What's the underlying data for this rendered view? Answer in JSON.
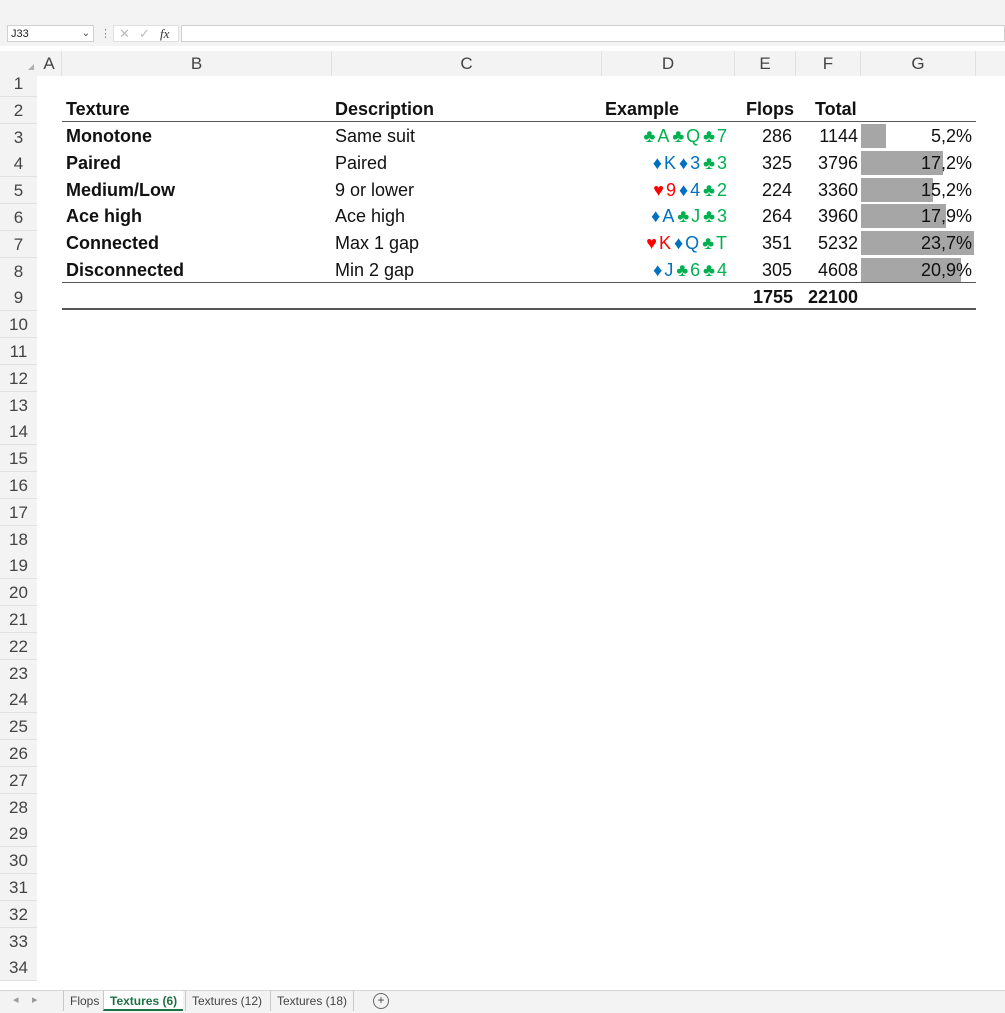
{
  "formula_bar": {
    "name_box": "J33",
    "fx_label": "fx",
    "cancel_icon": "✕",
    "enter_icon": "✓",
    "formula": ""
  },
  "columns": [
    "A",
    "B",
    "C",
    "D",
    "E",
    "F",
    "G"
  ],
  "rows": [
    "1",
    "2",
    "3",
    "4",
    "5",
    "6",
    "7",
    "8",
    "9",
    "10",
    "11",
    "12",
    "13",
    "14",
    "15",
    "16",
    "17",
    "18",
    "19",
    "20",
    "21",
    "22",
    "23",
    "24",
    "25",
    "26",
    "27",
    "28",
    "29",
    "30",
    "31",
    "32",
    "33",
    "34"
  ],
  "table": {
    "headers": {
      "texture": "Texture",
      "description": "Description",
      "example": "Example",
      "flops": "Flops",
      "total": "Total"
    },
    "rows": [
      {
        "texture": "Monotone",
        "description": "Same suit",
        "flops": "286",
        "total": "1144",
        "pct": "5,2%",
        "pct_value": 5.2,
        "example": [
          {
            "suit": "♣",
            "rank": "A",
            "color": "#00b050"
          },
          {
            "suit": "♣",
            "rank": "Q",
            "color": "#00b050"
          },
          {
            "suit": "♣",
            "rank": "7",
            "color": "#00b050"
          }
        ]
      },
      {
        "texture": "Paired",
        "description": "Paired",
        "flops": "325",
        "total": "3796",
        "pct": "17,2%",
        "pct_value": 17.2,
        "example": [
          {
            "suit": "♦",
            "rank": "K",
            "color": "#0070c0"
          },
          {
            "suit": "♦",
            "rank": "3",
            "color": "#0070c0"
          },
          {
            "suit": "♣",
            "rank": "3",
            "color": "#00b050"
          }
        ]
      },
      {
        "texture": "Medium/Low",
        "description": "9 or lower",
        "flops": "224",
        "total": "3360",
        "pct": "15,2%",
        "pct_value": 15.2,
        "example": [
          {
            "suit": "♥",
            "rank": "9",
            "color": "#ff0000"
          },
          {
            "suit": "♦",
            "rank": "4",
            "color": "#0070c0"
          },
          {
            "suit": "♣",
            "rank": "2",
            "color": "#00b050"
          }
        ]
      },
      {
        "texture": "Ace high",
        "description": "Ace high",
        "flops": "264",
        "total": "3960",
        "pct": "17,9%",
        "pct_value": 17.9,
        "example": [
          {
            "suit": "♦",
            "rank": "A",
            "color": "#0070c0"
          },
          {
            "suit": "♣",
            "rank": "J",
            "color": "#00b050"
          },
          {
            "suit": "♣",
            "rank": "3",
            "color": "#00b050"
          }
        ]
      },
      {
        "texture": "Connected",
        "description": "Max 1 gap",
        "flops": "351",
        "total": "5232",
        "pct": "23,7%",
        "pct_value": 23.7,
        "example": [
          {
            "suit": "♥",
            "rank": "K",
            "color": "#ff0000"
          },
          {
            "suit": "♦",
            "rank": "Q",
            "color": "#0070c0"
          },
          {
            "suit": "♣",
            "rank": "T",
            "color": "#00b050"
          }
        ]
      },
      {
        "texture": "Disconnected",
        "description": "Min 2 gap",
        "flops": "305",
        "total": "4608",
        "pct": "20,9%",
        "pct_value": 20.9,
        "example": [
          {
            "suit": "♦",
            "rank": "J",
            "color": "#0070c0"
          },
          {
            "suit": "♣",
            "rank": "6",
            "color": "#00b050"
          },
          {
            "suit": "♣",
            "rank": "4",
            "color": "#00b050"
          }
        ]
      }
    ],
    "totals": {
      "flops": "1755",
      "total": "22100"
    },
    "bar_color": "#a6a6a6",
    "bar_max_pct": 23.7
  },
  "sheet_tabs": [
    {
      "label": "Flops",
      "active": false
    },
    {
      "label": "Textures (6)",
      "active": true
    },
    {
      "label": "Textures (12)",
      "active": false
    },
    {
      "label": "Textures (18)",
      "active": false
    }
  ],
  "add_sheet_label": "+"
}
